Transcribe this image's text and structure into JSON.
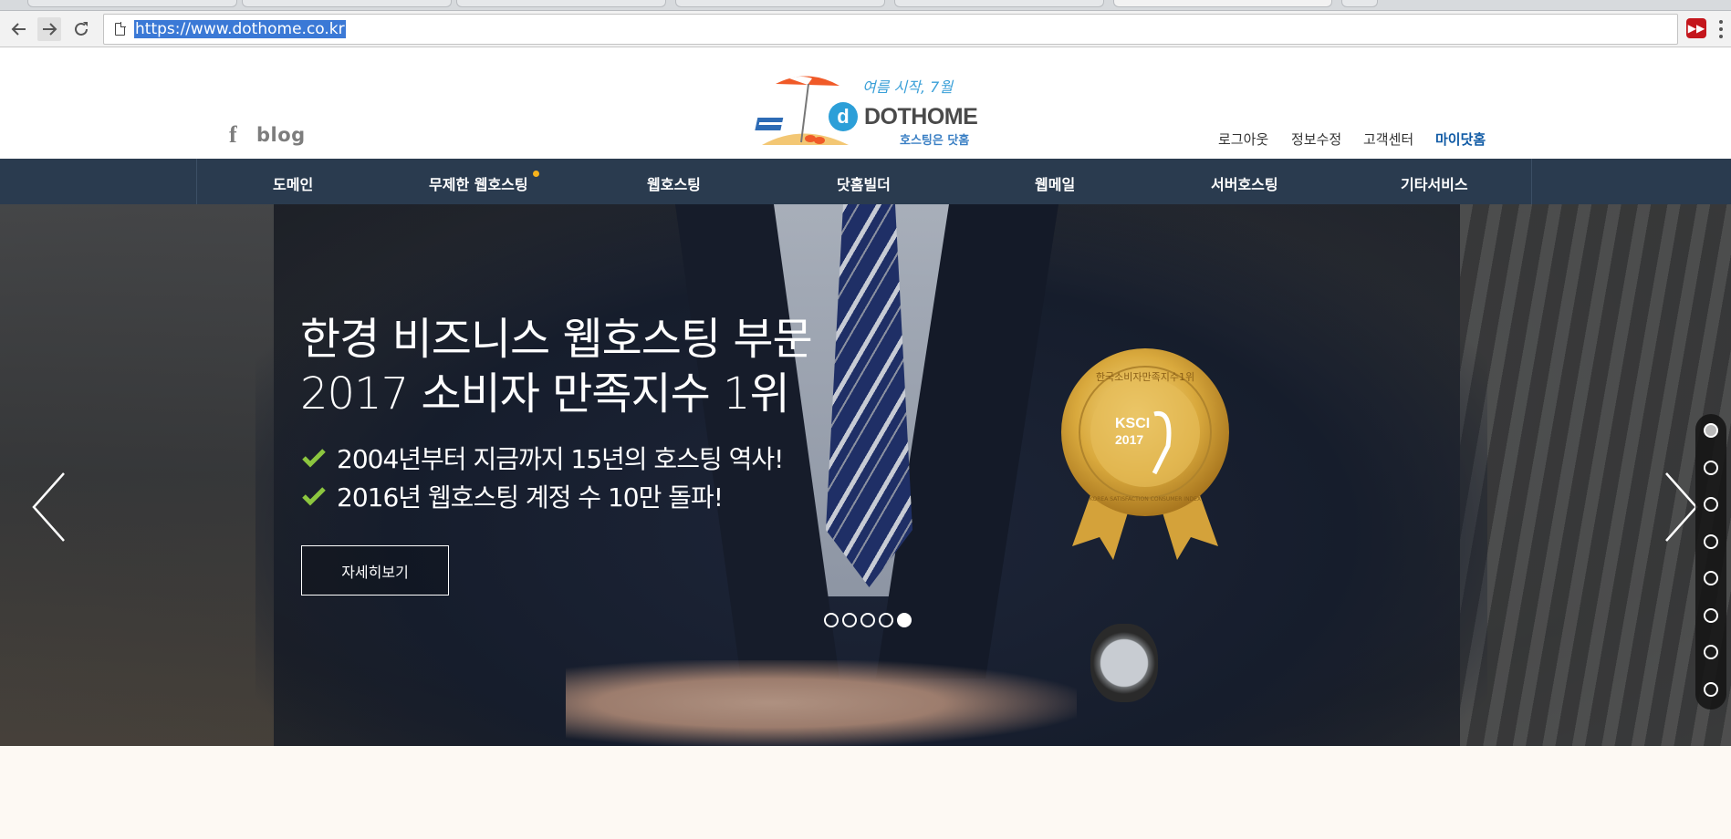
{
  "browser": {
    "url": "https://www.dothome.co.kr"
  },
  "header": {
    "blog_label": "blog",
    "logo": {
      "tagline": "여름 시작, 7월",
      "brand": "DOTHOME",
      "brand_sub": "호스팅은 닷홈",
      "badge": "d"
    },
    "util_links": [
      "로그아웃",
      "정보수정",
      "고객센터",
      "마이닷홈"
    ]
  },
  "nav": {
    "items": [
      "도메인",
      "무제한 웹호스팅",
      "웹호스팅",
      "닷홈빌더",
      "웹메일",
      "서버호스팅",
      "기타서비스"
    ]
  },
  "hero": {
    "title_lines": [
      "한경 비즈니스 웹호스팅 부문",
      "2017 소비자 만족지수 1위"
    ],
    "bullets": [
      "2004년부터 지금까지 15년의 호스팅 역사!",
      "2016년 웹호스팅 계정 수 10만 돌파!"
    ],
    "button_label": "자세히보기",
    "medal": {
      "ring_text": "한국소비자만족지수1위",
      "center": "KSCI",
      "year": "2017",
      "bottom_text": "KOREA SATISFACTION CONSUMER INDEX"
    },
    "slide_count": 5,
    "active_slide": 5,
    "section_count": 8,
    "active_section": 1
  },
  "colors": {
    "nav_bg": "#2a3b4f",
    "accent_link": "#0f5aa5",
    "check": "#8cc63f",
    "nav_dot": "#f6b21b"
  }
}
